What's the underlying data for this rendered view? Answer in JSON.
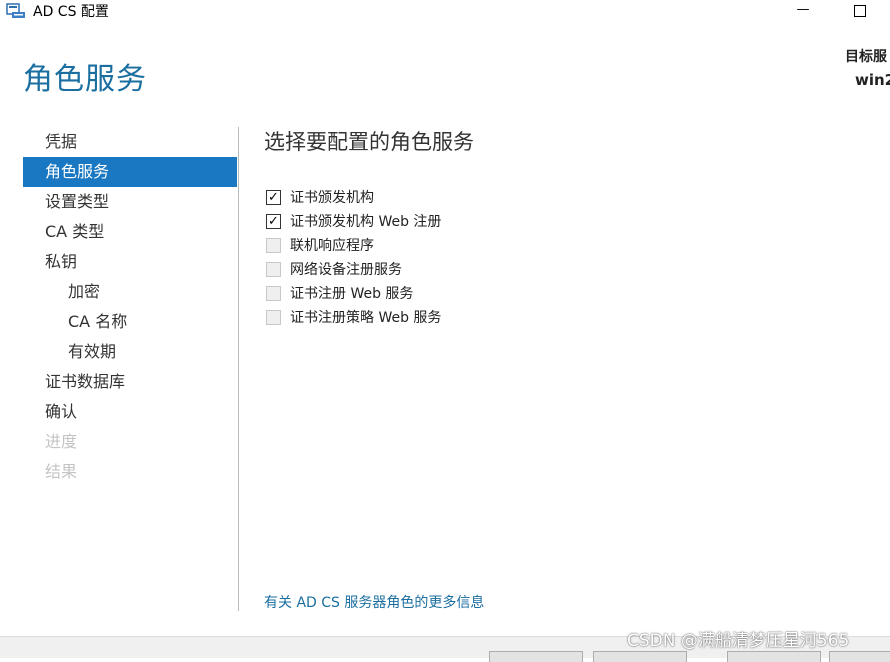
{
  "window": {
    "title": "AD CS 配置",
    "minimize_glyph": "—",
    "icon": "server-config-icon"
  },
  "header": {
    "page_title": "角色服务",
    "target_label": "目标服",
    "target_value": "win2"
  },
  "nav": {
    "items": [
      {
        "label": "凭据",
        "state": "normal"
      },
      {
        "label": "角色服务",
        "state": "active"
      },
      {
        "label": "设置类型",
        "state": "normal"
      },
      {
        "label": "CA 类型",
        "state": "normal"
      },
      {
        "label": "私钥",
        "state": "normal"
      },
      {
        "label": "加密",
        "state": "sub"
      },
      {
        "label": "CA 名称",
        "state": "sub"
      },
      {
        "label": "有效期",
        "state": "sub"
      },
      {
        "label": "证书数据库",
        "state": "normal"
      },
      {
        "label": "确认",
        "state": "normal"
      },
      {
        "label": "进度",
        "state": "disabled"
      },
      {
        "label": "结果",
        "state": "disabled"
      }
    ]
  },
  "main": {
    "section_title": "选择要配置的角色服务",
    "roles": [
      {
        "label": "证书颁发机构",
        "checked": true
      },
      {
        "label": "证书颁发机构 Web 注册",
        "checked": true
      },
      {
        "label": "联机响应程序",
        "checked": false
      },
      {
        "label": "网络设备注册服务",
        "checked": false
      },
      {
        "label": "证书注册 Web 服务",
        "checked": false
      },
      {
        "label": "证书注册策略 Web 服务",
        "checked": false
      }
    ],
    "checkmark_glyph": "✓",
    "more_info_link": "有关 AD CS 服务器角色的更多信息"
  },
  "watermark": "CSDN @满船清梦压星河565",
  "colors": {
    "accent": "#1a78c2",
    "title": "#1a6ea0",
    "disabled_text": "#c4c4c4"
  }
}
